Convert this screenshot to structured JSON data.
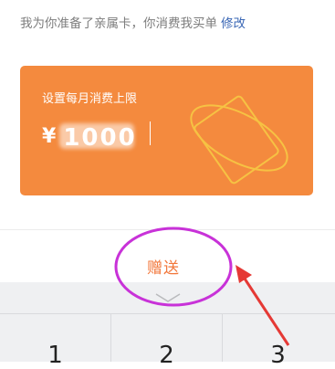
{
  "note": {
    "text": "我为你准备了亲属卡，你消费我买单",
    "edit_label": "修改"
  },
  "card": {
    "label": "设置每月消费上限",
    "currency": "¥",
    "amount": "1000",
    "color": "#f48a3e"
  },
  "gift_button": {
    "label": "赠送"
  },
  "keyboard": {
    "keys": [
      "1",
      "2",
      "3"
    ],
    "toggle_icon": "chevron-down-icon"
  },
  "annotation": {
    "ellipse_color": "#c832d8",
    "arrow_color": "#e53935"
  }
}
